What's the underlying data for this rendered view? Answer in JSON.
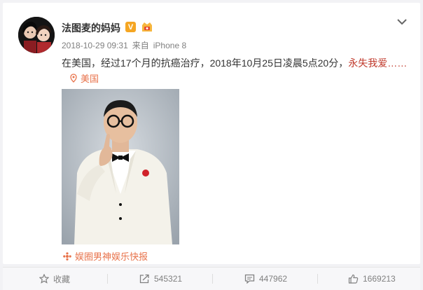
{
  "post": {
    "author": "法图麦的妈妈",
    "verified_badge": "V",
    "timestamp": "2018-10-29 09:31",
    "source_prefix": "来自",
    "device": "iPhone 8",
    "text": "在美国，经过17个月的抗癌治疗，2018年10月25日凌晨5点20分，",
    "text_highlight": "永失我爱……",
    "location": "美国",
    "source_tag": "娱圈男神娱乐快报"
  },
  "footer": {
    "favorite_label": "收藏",
    "repost_count": "545321",
    "comment_count": "447962",
    "like_count": "1669213"
  },
  "colors": {
    "accent_orange": "#e8734b",
    "highlight_red": "#c0392b",
    "badge_gold": "#f5a623"
  },
  "icons": [
    "chevron-down-icon",
    "location-pin-icon",
    "source-tag-icon",
    "star-icon",
    "repost-icon",
    "comment-icon",
    "thumbs-up-icon"
  ]
}
